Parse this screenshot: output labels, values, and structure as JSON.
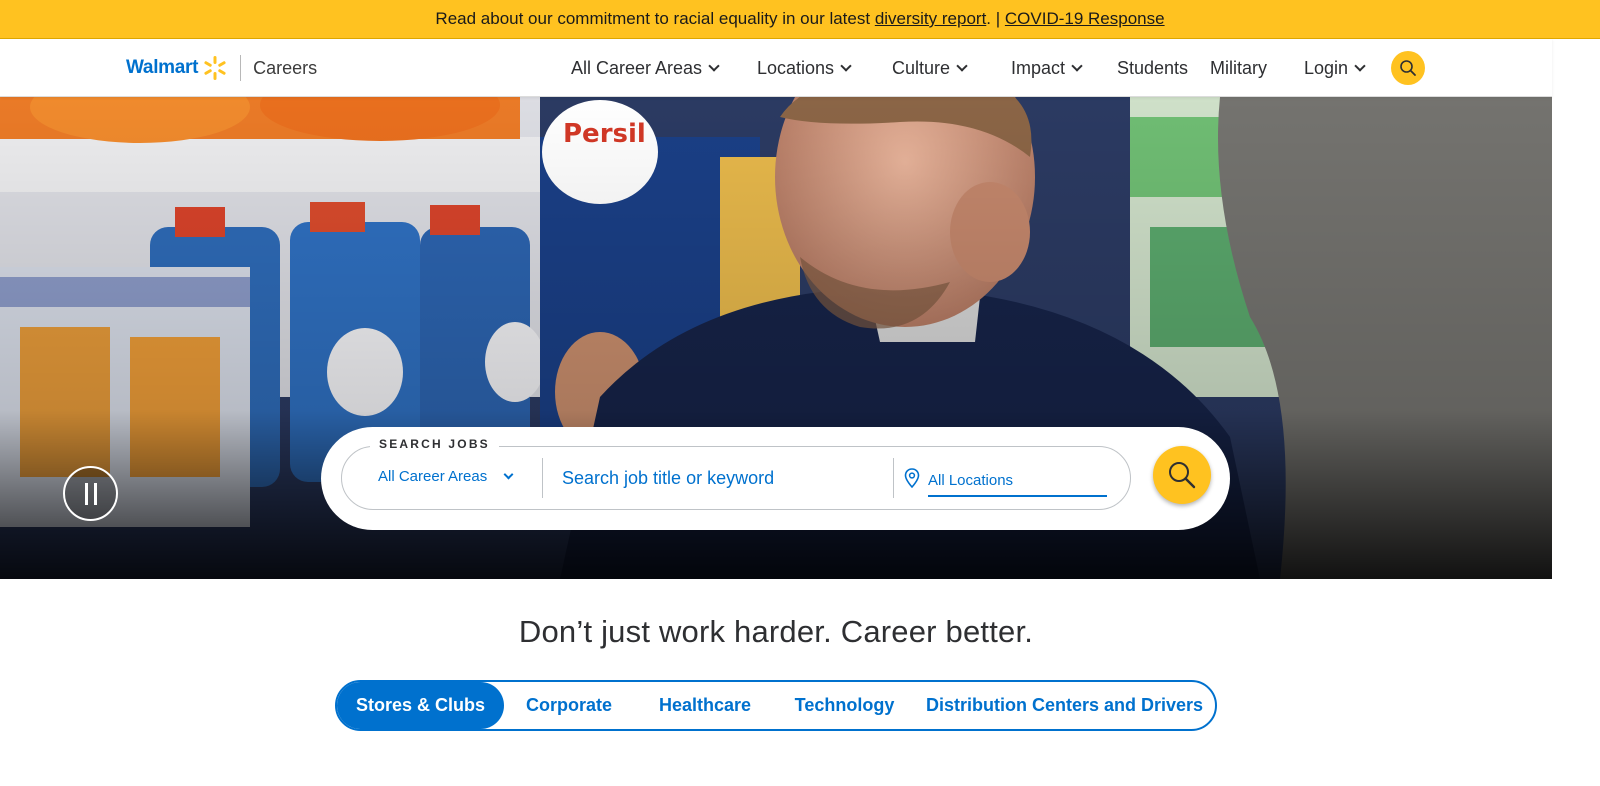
{
  "announcement": {
    "prefix": "Read about our commitment to racial equality in our latest ",
    "diversity_link": "diversity report",
    "middle": ". | ",
    "covid_link": "COVID-19 Response"
  },
  "header": {
    "logo_text": "Walmart",
    "careers_label": "Careers",
    "nav": [
      {
        "label": "All Career Areas",
        "dropdown": true
      },
      {
        "label": "Locations",
        "dropdown": true
      },
      {
        "label": "Culture",
        "dropdown": true
      },
      {
        "label": "Impact",
        "dropdown": true
      },
      {
        "label": "Students",
        "dropdown": false
      },
      {
        "label": "Military",
        "dropdown": false
      },
      {
        "label": "Login",
        "dropdown": true
      }
    ],
    "search_icon": "search-icon"
  },
  "hero": {
    "pause_icon": "pause-icon",
    "search": {
      "legend": "SEARCH JOBS",
      "career_area_value": "All Career Areas",
      "keyword_placeholder": "Search job title or keyword",
      "location_placeholder": "All Locations",
      "submit_icon": "search-icon"
    }
  },
  "tagline": "Don’t just work harder. Career better.",
  "tabs": [
    {
      "label": "Stores & Clubs",
      "active": true
    },
    {
      "label": "Corporate",
      "active": false
    },
    {
      "label": "Healthcare",
      "active": false
    },
    {
      "label": "Technology",
      "active": false
    },
    {
      "label": "Distribution Centers and Drivers",
      "active": false
    }
  ],
  "colors": {
    "brand_blue": "#0071ce",
    "brand_yellow": "#ffc220"
  }
}
